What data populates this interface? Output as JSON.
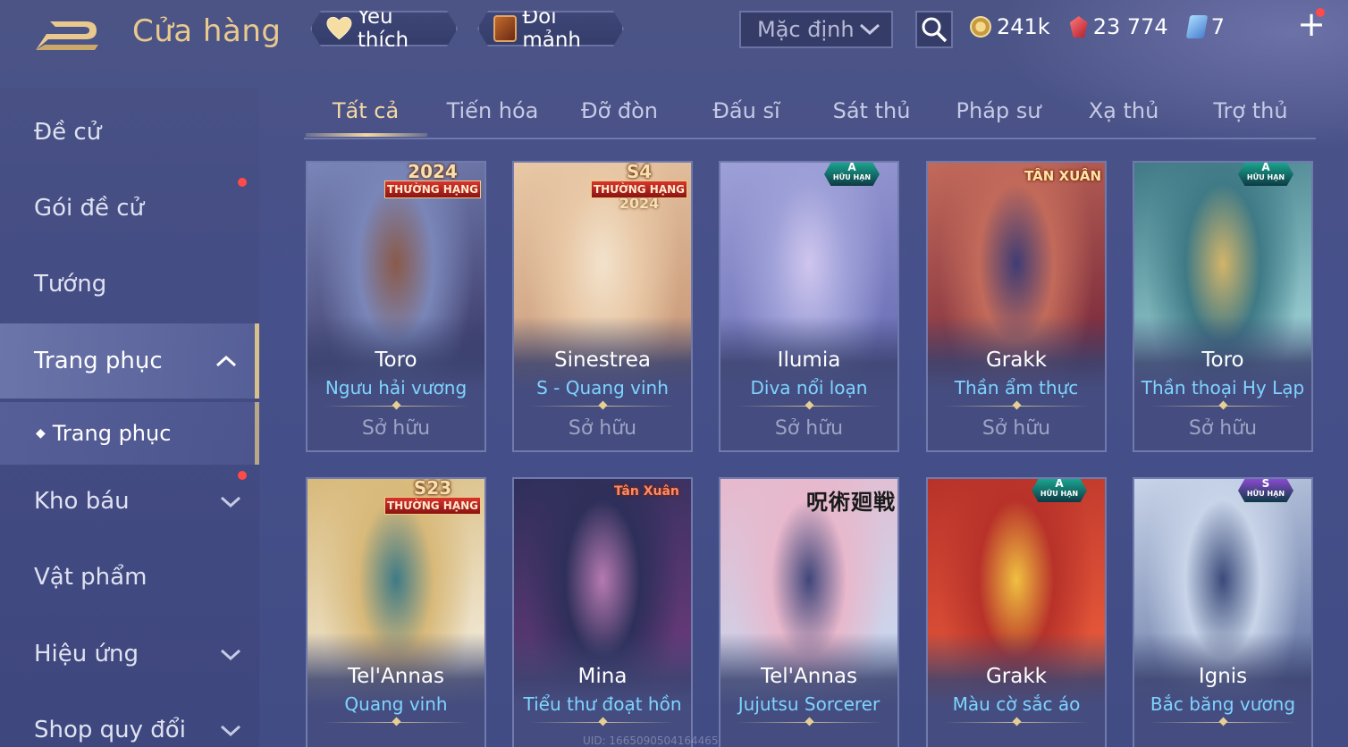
{
  "header": {
    "title": "Cửa hàng",
    "favorites_label": "Yêu thích",
    "shards_label": "Đổi mảnh",
    "sort_value": "Mặc định",
    "currencies": [
      {
        "icon": "gold-coin-icon",
        "value": "241k"
      },
      {
        "icon": "ruby-icon",
        "value": "23 774"
      },
      {
        "icon": "voucher-icon",
        "value": "7"
      }
    ],
    "add_label": "+"
  },
  "sidebar": {
    "items": [
      {
        "label": "Đề cử"
      },
      {
        "label": "Gói đề cử",
        "notification": true
      },
      {
        "label": "Tướng"
      },
      {
        "label": "Trang phục",
        "expanded": true,
        "active": true
      },
      {
        "label": "Trang phục",
        "sub": true,
        "selected": true
      },
      {
        "label": "Kho báu",
        "notification": true
      },
      {
        "label": "Vật phẩm"
      },
      {
        "label": "Hiệu ứng"
      },
      {
        "label": "Shop quy đổi"
      }
    ]
  },
  "tabs": [
    {
      "label": "Tất cả",
      "active": true
    },
    {
      "label": "Tiến hóa"
    },
    {
      "label": "Đỡ đòn"
    },
    {
      "label": "Đấu sĩ"
    },
    {
      "label": "Sát thủ"
    },
    {
      "label": "Pháp sư"
    },
    {
      "label": "Xạ thủ"
    },
    {
      "label": "Trợ thủ"
    }
  ],
  "skins": [
    {
      "hero": "Toro",
      "skin": "Ngưu hải vương",
      "status": "Sở hữu",
      "badge": "rank",
      "badge_top": "2024",
      "badge_label": "THƯỜNG HẠNG",
      "art": [
        "#7a86b8",
        "#3f3f6e",
        "#8a5a4a"
      ]
    },
    {
      "hero": "Sinestrea",
      "skin": "S - Quang vinh",
      "status": "Sở hữu",
      "badge": "rank2",
      "badge_top": "S4",
      "badge_label": "THƯỜNG HẠNG",
      "badge_bottom": "2024",
      "art": [
        "#e8c8a6",
        "#c99a7a",
        "#f2e2cc"
      ]
    },
    {
      "hero": "Ilumia",
      "skin": "Diva nổi loạn",
      "status": "Sở hữu",
      "badge": "tier",
      "tier_letter": "A",
      "tier_text": "HỮU HẠN",
      "tier_color": "#1aa58f",
      "art": [
        "#9ea0d8",
        "#6c6fb6",
        "#cfc6ee"
      ]
    },
    {
      "hero": "Grakk",
      "skin": "Thần ẩm thực",
      "status": "Sở hữu",
      "badge": "event",
      "event_text": "TÂN XUÂN",
      "art": [
        "#c26a5a",
        "#7a2a3c",
        "#3f3c74"
      ]
    },
    {
      "hero": "Toro",
      "skin": "Thần thoại Hy Lạp",
      "status": "Sở hữu",
      "badge": "tier",
      "tier_letter": "A",
      "tier_text": "HỮU HẠN",
      "tier_color": "#1aa58f",
      "art": [
        "#3f7a86",
        "#9ed2d6",
        "#d2b46a"
      ]
    },
    {
      "hero": "Tel'Annas",
      "skin": "Quang vinh",
      "badge": "rank",
      "badge_top": "S23",
      "badge_label": "THƯỜNG HẠNG",
      "art": [
        "#d8b97a",
        "#f1ead8",
        "#3e7a86"
      ]
    },
    {
      "hero": "Mina",
      "skin": "Tiểu thư đoạt hồn",
      "badge": "event",
      "event_text": "Tân Xuân",
      "art": [
        "#2e2f5a",
        "#6a3a7a",
        "#b67ab0"
      ]
    },
    {
      "hero": "Tel'Annas",
      "skin": "Jujutsu Sorcerer",
      "badge": "collab",
      "collab_text": "呪術廻戦",
      "art": [
        "#e8b8cc",
        "#c8d8f0",
        "#40467a"
      ]
    },
    {
      "hero": "Grakk",
      "skin": "Màu cờ sắc áo",
      "badge": "tier",
      "tier_letter": "A",
      "tier_text": "HỮU HẠN",
      "tier_color": "#1aa58f",
      "art": [
        "#b8322a",
        "#e85a3a",
        "#f0c040"
      ]
    },
    {
      "hero": "Ignis",
      "skin": "Bắc băng vương",
      "badge": "tier",
      "tier_letter": "S",
      "tier_text": "HỮU HẠN",
      "tier_color": "#8a4ad0",
      "art": [
        "#c8d4e8",
        "#6a7aa8",
        "#3a4a7a"
      ]
    }
  ],
  "footer_watermark": "UID: 1665090504164465",
  "colors": {
    "accent_gold": "#f3d9a2",
    "skin_blue": "#7fd4ff",
    "notification_red": "#ff4a4a"
  }
}
